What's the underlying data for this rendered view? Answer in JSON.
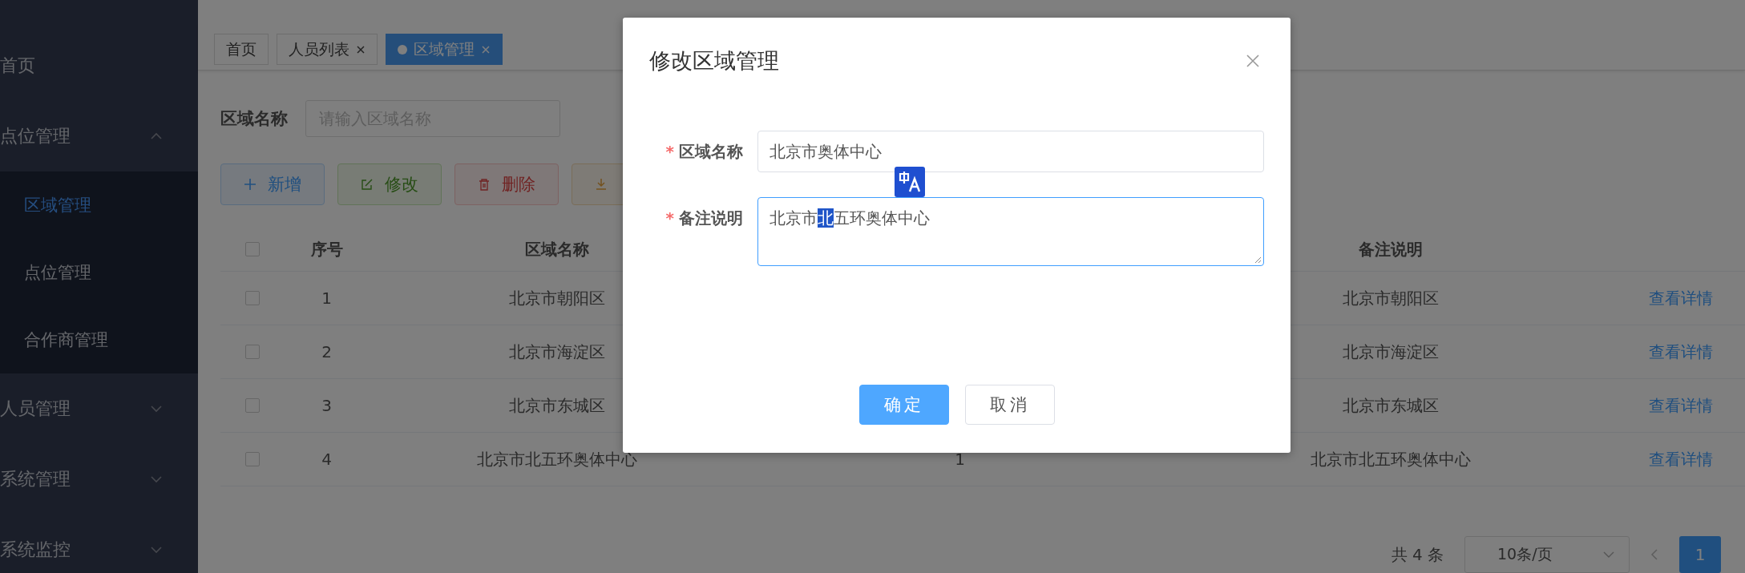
{
  "sidebar": {
    "items": [
      {
        "label": "首页"
      },
      {
        "label": "点位管理",
        "expanded": true,
        "children": [
          {
            "label": "区域管理",
            "selected": true
          },
          {
            "label": "点位管理",
            "selected": false
          },
          {
            "label": "合作商管理",
            "selected": false
          }
        ]
      },
      {
        "label": "人员管理",
        "expanded": false
      },
      {
        "label": "系统管理",
        "expanded": false
      },
      {
        "label": "系统监控",
        "expanded": false
      }
    ]
  },
  "tabs": [
    {
      "label": "首页",
      "selected": false,
      "closable": false
    },
    {
      "label": "人员列表",
      "selected": false,
      "closable": true
    },
    {
      "label": "区域管理",
      "selected": true,
      "closable": true
    }
  ],
  "search": {
    "label": "区域名称",
    "placeholder": "请输入区域名称"
  },
  "toolbar": [
    {
      "kind": "primary",
      "label": "新增"
    },
    {
      "kind": "success",
      "label": "修改"
    },
    {
      "kind": "danger",
      "label": "删除"
    },
    {
      "kind": "warning"
    }
  ],
  "table": {
    "header_checked": false,
    "columns": {
      "index": "序号",
      "name": "区域名称",
      "remark": "备注说明"
    },
    "rows": [
      {
        "checked": false,
        "index": "1",
        "name": "北京市朝阳区",
        "remark": "北京市朝阳区",
        "action": "查看详情"
      },
      {
        "checked": false,
        "index": "2",
        "name": "北京市海淀区",
        "remark": "北京市海淀区",
        "action": "查看详情"
      },
      {
        "checked": false,
        "index": "3",
        "name": "北京市东城区",
        "remark": "北京市东城区",
        "action": "查看详情"
      },
      {
        "checked": false,
        "index": "4",
        "name": "北京市北五环奥体中心",
        "column_4": "1",
        "remark": "北京市北五环奥体中心",
        "action": "查看详情"
      }
    ]
  },
  "pagination": {
    "total": "共 4 条",
    "page_size": "10条/页",
    "pages": [
      {
        "label": "1",
        "selected": true
      }
    ]
  },
  "dialog": {
    "title": "修改区域管理",
    "fields": [
      {
        "kind": "input",
        "label": "区域名称",
        "required_mark": "*",
        "focused": false,
        "value": [
          {
            "text": "北京市奥体中心",
            "selected": false
          }
        ]
      },
      {
        "kind": "textarea",
        "label": "备注说明",
        "required_mark": "*",
        "focused": true,
        "value": [
          {
            "text": "北京市",
            "selected": false
          },
          {
            "text": "北",
            "selected": true
          },
          {
            "text": "五环奥体中心",
            "selected": false
          }
        ]
      }
    ],
    "buttons": [
      {
        "kind": "primary",
        "label": "确定"
      },
      {
        "kind": "default",
        "label": "取消"
      }
    ]
  }
}
